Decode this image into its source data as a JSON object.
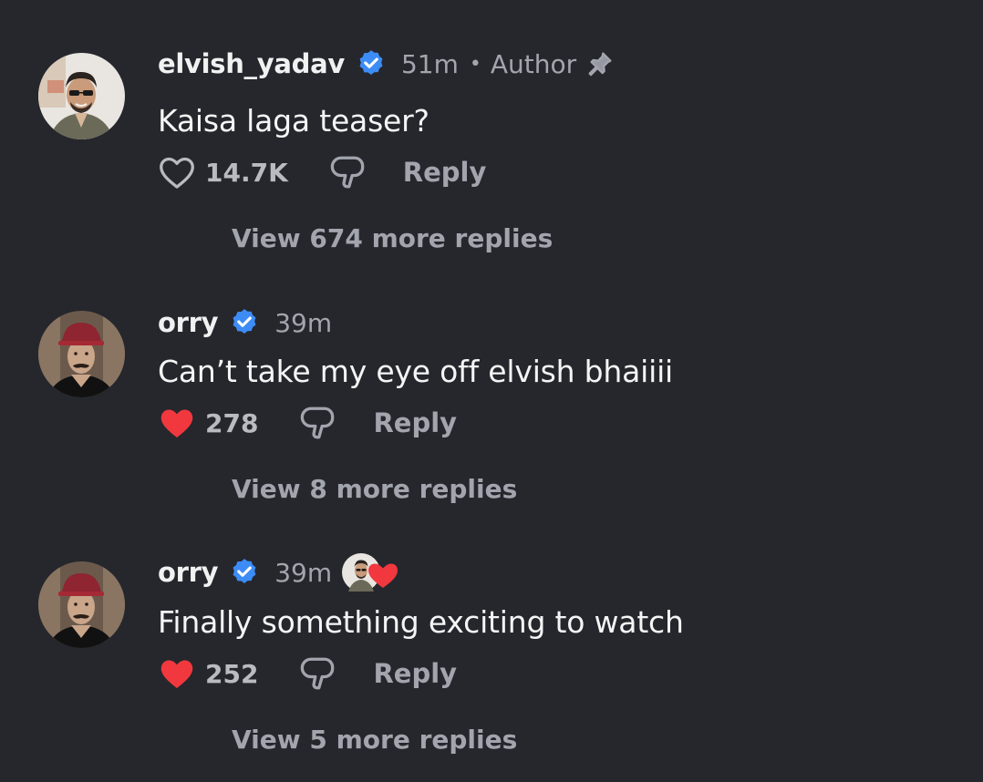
{
  "colors": {
    "background": "#25272c",
    "verified_badge": "#3d8cf6",
    "liked_heart": "#f0383e",
    "muted_text": "#a2a5ad"
  },
  "comments": [
    {
      "username": "elvish_yadav",
      "verified": true,
      "time": "51m",
      "author_label": "Author",
      "pinned": true,
      "text": "Kaisa laga teaser?",
      "likes": "14.7K",
      "liked": false,
      "reply_label": "Reply",
      "view_more": "View 674 more replies",
      "avatar_icon": "avatar-elvish"
    },
    {
      "username": "orry",
      "verified": true,
      "time": "39m",
      "text": "Can’t take my eye off elvish bhaiiii",
      "likes": "278",
      "liked": true,
      "reply_label": "Reply",
      "view_more": "View 8 more replies",
      "avatar_icon": "avatar-orry"
    },
    {
      "username": "orry",
      "verified": true,
      "time": "39m",
      "liked_by_creator": true,
      "text": "Finally something exciting to watch",
      "likes": "252",
      "liked": true,
      "reply_label": "Reply",
      "view_more": "View 5 more replies",
      "avatar_icon": "avatar-orry"
    }
  ]
}
